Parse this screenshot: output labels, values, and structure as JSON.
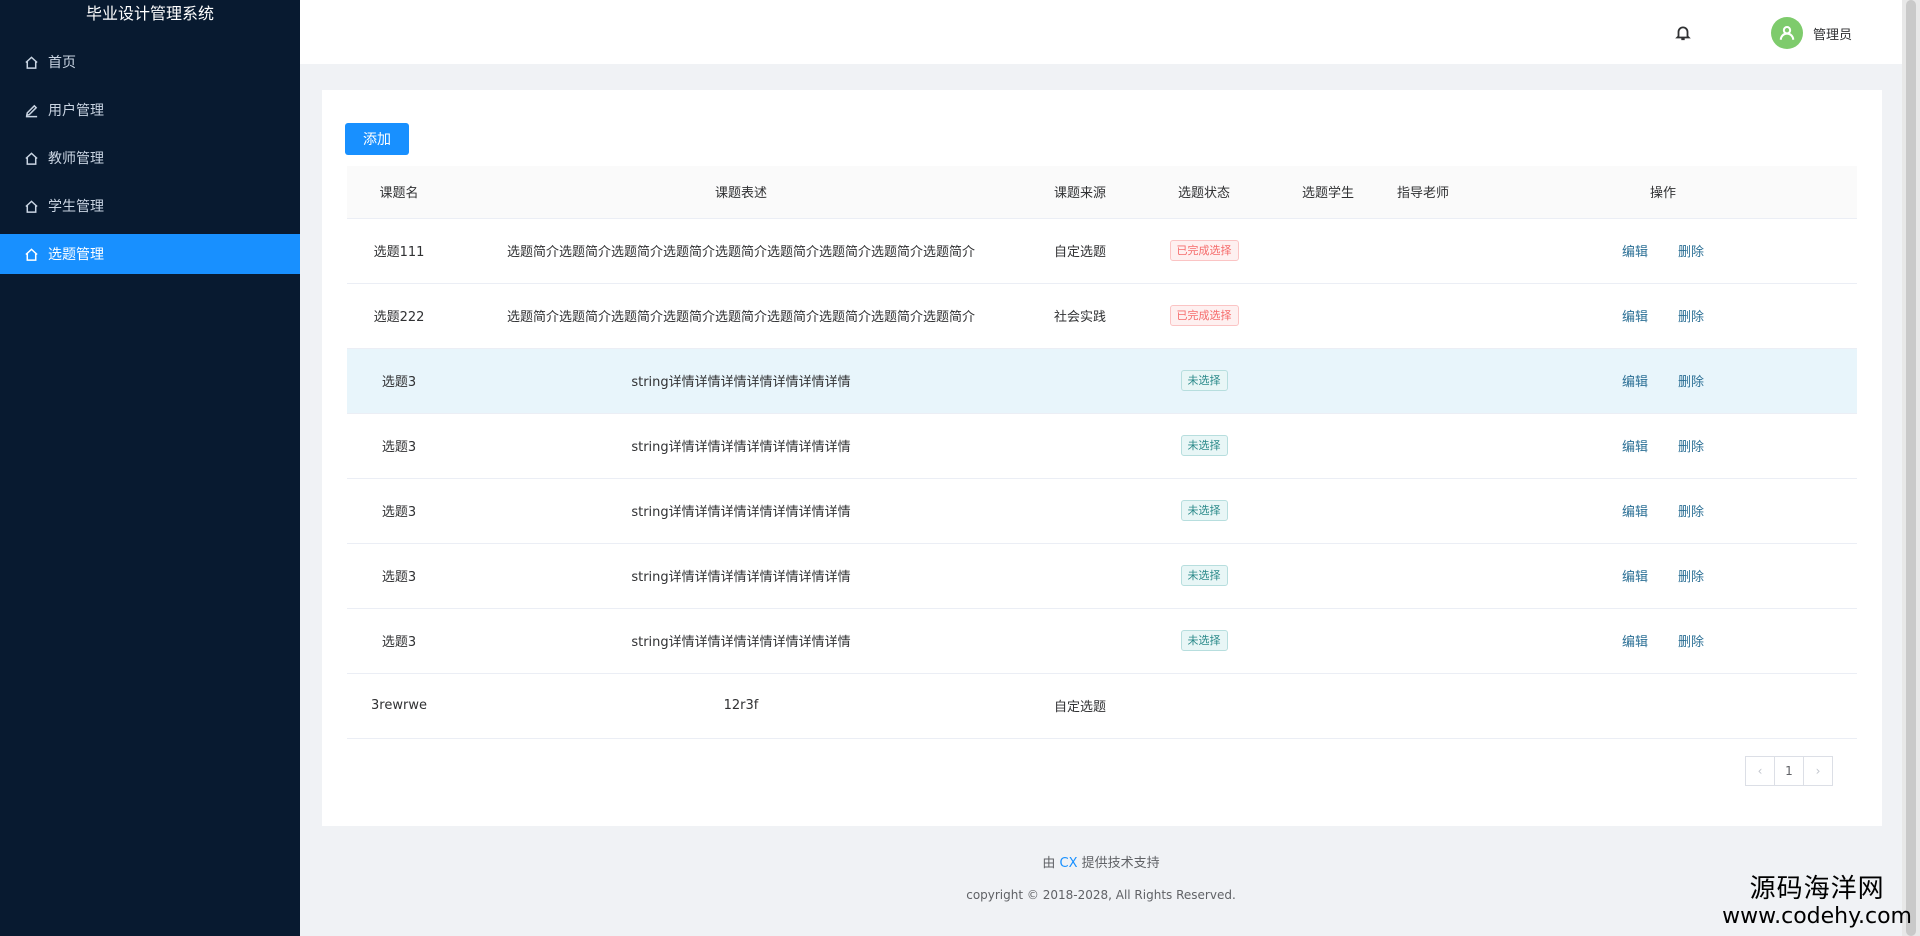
{
  "app": {
    "title": "毕业设计管理系统"
  },
  "sidebar": {
    "items": [
      {
        "label": "首页",
        "icon": "home-icon"
      },
      {
        "label": "用户管理",
        "icon": "edit-icon"
      },
      {
        "label": "教师管理",
        "icon": "home-icon"
      },
      {
        "label": "学生管理",
        "icon": "home-icon"
      },
      {
        "label": "选题管理",
        "icon": "home-icon",
        "active": true
      }
    ]
  },
  "header": {
    "username": "管理员"
  },
  "toolbar": {
    "add_label": "添加"
  },
  "table": {
    "columns": [
      "课题名",
      "课题表述",
      "课题来源",
      "选题状态",
      "选题学生",
      "指导老师",
      "操作"
    ],
    "rows": [
      {
        "name": "选题111",
        "desc": "选题简介选题简介选题简介选题简介选题简介选题简介选题简介选题简介选题简介",
        "source": "自定选题",
        "status": "已完成选择",
        "student": "",
        "teacher": ""
      },
      {
        "name": "选题222",
        "desc": "选题简介选题简介选题简介选题简介选题简介选题简介选题简介选题简介选题简介",
        "source": "社会实践",
        "status": "已完成选择",
        "student": "",
        "teacher": ""
      },
      {
        "name": "选题3",
        "desc": "string详情详情详情详情详情详情详情",
        "source": "",
        "status": "未选择",
        "student": "",
        "teacher": ""
      },
      {
        "name": "选题3",
        "desc": "string详情详情详情详情详情详情详情",
        "source": "",
        "status": "未选择",
        "student": "",
        "teacher": ""
      },
      {
        "name": "选题3",
        "desc": "string详情详情详情详情详情详情详情",
        "source": "",
        "status": "未选择",
        "student": "",
        "teacher": ""
      },
      {
        "name": "选题3",
        "desc": "string详情详情详情详情详情详情详情",
        "source": "",
        "status": "未选择",
        "student": "",
        "teacher": ""
      },
      {
        "name": "选题3",
        "desc": "string详情详情详情详情详情详情详情",
        "source": "",
        "status": "未选择",
        "student": "",
        "teacher": ""
      },
      {
        "name": "3rewrwe",
        "desc": "12r3f",
        "source": "自定选题",
        "status": "",
        "student": "",
        "teacher": ""
      }
    ],
    "actions": {
      "edit": "编辑",
      "delete": "删除"
    }
  },
  "pagination": {
    "prev": "‹",
    "page": "1",
    "next": "›"
  },
  "footer": {
    "support_prefix": "由",
    "support_name": "CX",
    "support_suffix": "提供技术支持",
    "copyright": "copyright © 2018-2028, All Rights Reserved."
  },
  "watermark": {
    "cn": "源码海洋网",
    "url": "www.codehy.com"
  },
  "colors": {
    "sidebar_bg": "#081a30",
    "accent": "#1890ff",
    "done_tag": "#f56c6c",
    "none_tag": "#2b8a8a"
  }
}
